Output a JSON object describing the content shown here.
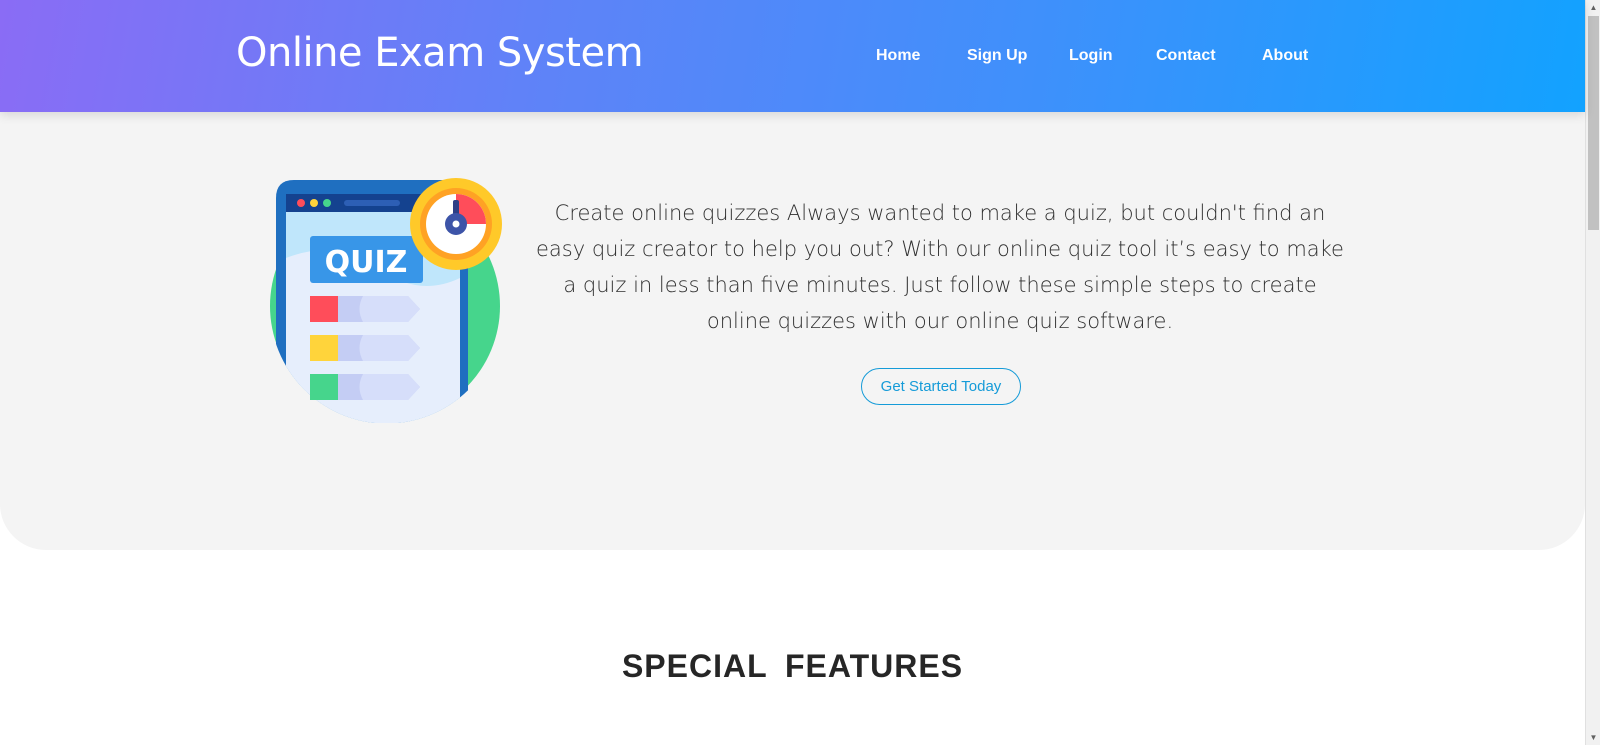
{
  "header": {
    "brand": "Online Exam System",
    "nav": [
      {
        "label": "Home"
      },
      {
        "label": "Sign Up"
      },
      {
        "label": "Login"
      },
      {
        "label": "Contact"
      },
      {
        "label": "About"
      }
    ]
  },
  "hero": {
    "illustration_label": "QUIZ",
    "description": "Create online quizzes Always wanted to make a quiz, but couldn't find an easy quiz creator to help you out? With our online quiz tool it’s easy to make a quiz in less than five minutes. Just follow these simple steps to create online quizzes with our online quiz software.",
    "cta_label": "Get Started Today"
  },
  "features": {
    "title": "SPECIAL  FEATURES"
  },
  "colors": {
    "header_gradient_start": "#8a6cf5",
    "header_gradient_end": "#12a2ff",
    "accent": "#159bd8",
    "hero_bg": "#f4f4f4"
  },
  "icons": {
    "scroll_up": "chevron-up-icon",
    "scroll_down": "chevron-down-icon"
  }
}
